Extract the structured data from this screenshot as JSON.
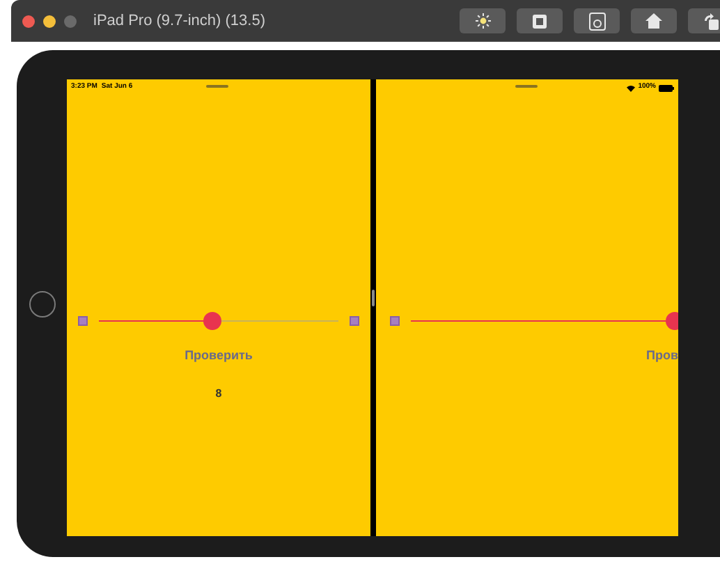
{
  "simulator": {
    "title": "iPad Pro (9.7-inch) (13.5)",
    "toolbar": [
      {
        "kind": "brightness"
      },
      {
        "kind": "shake"
      },
      {
        "kind": "screenshot"
      },
      {
        "kind": "home"
      },
      {
        "kind": "rotate"
      }
    ]
  },
  "left_pane": {
    "status": {
      "time": "3:23 PM",
      "date": "Sat Jun 6"
    },
    "slider": {
      "level": 0.47
    },
    "button": "Проверить",
    "value": "8"
  },
  "right_pane": {
    "status": {
      "battery": "100%"
    },
    "slider": {
      "level": 1
    },
    "button": "Пров"
  }
}
